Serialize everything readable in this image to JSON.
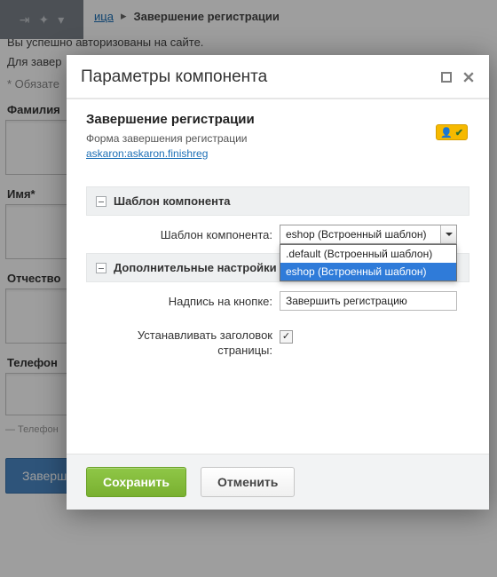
{
  "bg": {
    "breadcrumb_a": "ица",
    "breadcrumb_current": "Завершение регистрации",
    "line1": "Вы успешно авторизованы на сайте.",
    "line2": "Для завер",
    "required_note": "* Обязате",
    "labels": {
      "surname": "Фамилия",
      "name": "Имя*",
      "patronymic": "Отчество",
      "phone": "Телефон"
    },
    "phone_note": "— Телефон",
    "submit": "Завершить регистрацию"
  },
  "modal": {
    "title": "Параметры компонента",
    "component": {
      "heading": "Завершение регистрации",
      "description": "Форма завершения регистрации",
      "link": "askaron:askaron.finishreg"
    },
    "sections": {
      "template": "Шаблон компонента",
      "additional": "Дополнительные настройки"
    },
    "fields": {
      "template_label": "Шаблон компонента:",
      "template_value": "eshop (Встроенный шаблон)",
      "template_options": [
        ".default (Встроенный шаблон)",
        "eshop (Встроенный шаблон)"
      ],
      "button_text_label": "Надпись на кнопке:",
      "button_text_value": "Завершить регистрацию",
      "set_title_label": "Устанавливать заголовок страницы:"
    },
    "buttons": {
      "save": "Сохранить",
      "cancel": "Отменить"
    }
  }
}
